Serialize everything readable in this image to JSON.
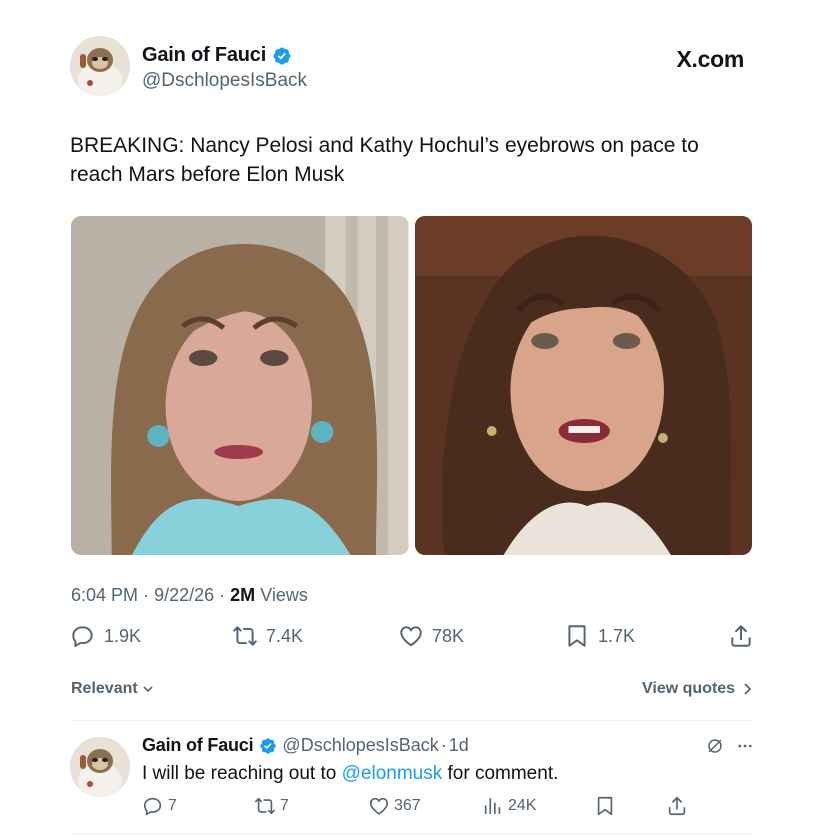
{
  "post": {
    "display_name": "Gain of Fauci",
    "handle": "@DschlopesIsBack",
    "brand": "X.com",
    "text": "BREAKING: Nancy Pelosi and Kathy Hochul’s eyebrows on pace to reach Mars before Elon Musk",
    "time": "6:04 PM",
    "date": "9/22/26",
    "sep": "·",
    "views_count": "2M",
    "views_label": "Views",
    "replies": "1.9K",
    "reposts": "7.4K",
    "likes": "78K",
    "bookmarks": "1.7K"
  },
  "filters": {
    "relevant": "Relevant",
    "view_quotes": "View quotes"
  },
  "reply": {
    "display_name": "Gain of Fauci",
    "handle": "@DschlopesIsBack",
    "age": "1d",
    "text_before": "I will be reaching out to ",
    "mention": "@elonmusk",
    "text_after": " for comment.",
    "replies": "7",
    "reposts": "7",
    "likes": "367",
    "views": "24K"
  },
  "colors": {
    "verified": "#1d9bf0",
    "muted": "#536471",
    "text": "#0f1419",
    "link": "#1d9bf0"
  },
  "icons": [
    "verified-badge-icon",
    "reply-icon",
    "repost-icon",
    "like-icon",
    "bookmark-icon",
    "share-icon",
    "chevron-down-icon",
    "chevron-right-icon",
    "grok-icon",
    "more-icon",
    "views-icon"
  ]
}
